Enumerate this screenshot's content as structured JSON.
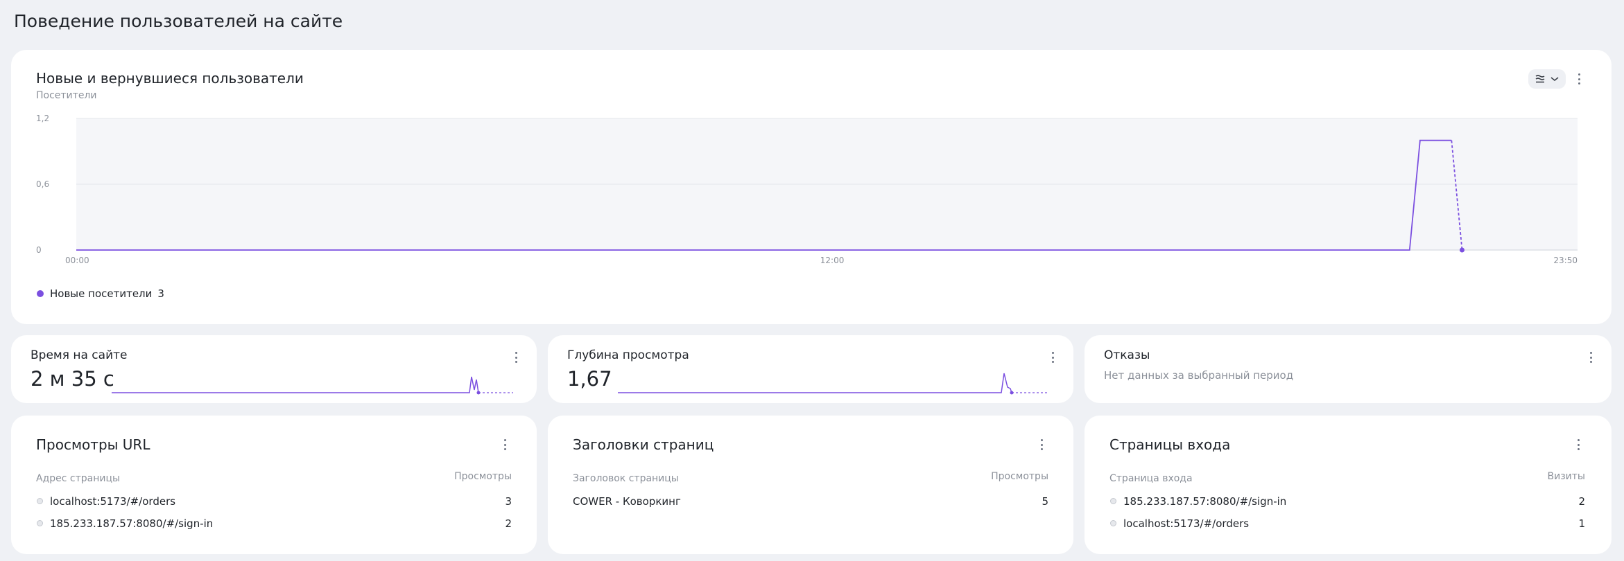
{
  "page": {
    "title": "Поведение пользователей на сайте"
  },
  "main_chart": {
    "title": "Новые и вернувшиеся пользователи",
    "subtitle": "Посетители",
    "controls": {
      "chart_type_icon": "chart-settings-icon",
      "dropdown_icon": "chevron-down-icon"
    },
    "legend": {
      "label": "Новые посетители",
      "count": "3"
    },
    "accent_color": "#7b4fe0"
  },
  "chart_data": {
    "type": "line",
    "title": "Новые и вернувшиеся пользователи",
    "ylabel": "Посетители",
    "x_ticks": [
      "00:00",
      "12:00",
      "23:50"
    ],
    "y_ticks": [
      "0",
      "0,6",
      "1,2"
    ],
    "ylim": [
      0,
      1.2
    ],
    "grid": true,
    "legend_position": "bottom-left",
    "series": [
      {
        "name": "Новые посетители",
        "color": "#7b4fe0",
        "points": [
          {
            "x": "00:00",
            "y": 0
          },
          {
            "x": "21:10",
            "y": 0
          },
          {
            "x": "21:20",
            "y": 1
          },
          {
            "x": "21:50",
            "y": 1
          },
          {
            "x": "22:00",
            "y": 0,
            "projected": true
          }
        ]
      }
    ]
  },
  "metrics": [
    {
      "title": "Время на сайте",
      "value": "2 м 35 с",
      "has_sparkline": true
    },
    {
      "title": "Глубина просмотра",
      "value": "1,67",
      "has_sparkline": true
    },
    {
      "title": "Отказы",
      "value": "",
      "no_data": "Нет данных за выбранный период",
      "has_sparkline": false
    }
  ],
  "tables": [
    {
      "title": "Просмотры URL",
      "col_left": "Адрес страницы",
      "col_right": "Просмотры",
      "rows": [
        {
          "label": "localhost:5173/#/orders",
          "value": "3"
        },
        {
          "label": "185.233.187.57:8080/#/sign-in",
          "value": "2"
        }
      ]
    },
    {
      "title": "Заголовки страниц",
      "col_left": "Заголовок страницы",
      "col_right": "Просмотры",
      "rows": [
        {
          "label": "COWER - Коворкинг",
          "value": "5"
        }
      ]
    },
    {
      "title": "Страницы входа",
      "col_left": "Страница входа",
      "col_right": "Визиты",
      "rows": [
        {
          "label": "185.233.187.57:8080/#/sign-in",
          "value": "2"
        },
        {
          "label": "localhost:5173/#/orders",
          "value": "1"
        }
      ]
    }
  ]
}
